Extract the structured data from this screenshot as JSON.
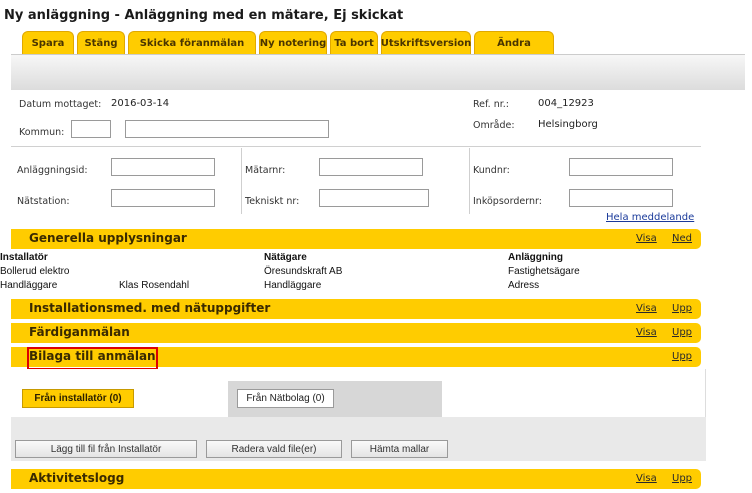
{
  "window": {
    "title": "Ny anläggning - Anläggning med en mätare, Ej skickat"
  },
  "toolbar": {
    "tabs": [
      "Spara",
      "Stäng",
      "Skicka föranmälan",
      "Ny notering",
      "Ta bort",
      "Utskriftsversion",
      "Ändra"
    ]
  },
  "header": {
    "datum_label": "Datum mottaget:",
    "datum_value": "2016-03-14",
    "kommun_label": "Kommun:",
    "ref_label": "Ref. nr.:",
    "ref_value": "004_12923",
    "omrade_label": "Område:",
    "omrade_value": "Helsingborg"
  },
  "fields": {
    "anlaggningsid": "Anläggningsid:",
    "natstation": "Nätstation:",
    "matarnr": "Mätarnr:",
    "tekniskt": "Tekniskt nr:",
    "kundnr": "Kundnr:",
    "inkopsordernr": "Inköpsordernr:",
    "hela_link": "Hela meddelande"
  },
  "sections": {
    "generella": {
      "title": "Generella upplysningar",
      "visa": "Visa",
      "toggle": "Ned"
    },
    "installationsmed": {
      "title": "Installationsmed. med nätuppgifter",
      "visa": "Visa",
      "toggle": "Upp"
    },
    "fardig": {
      "title": "Färdiganmälan",
      "visa": "Visa",
      "toggle": "Upp"
    },
    "bilaga": {
      "title": "Bilaga till anmälan",
      "toggle": "Upp"
    },
    "aktivitet": {
      "title": "Aktivitetslogg",
      "visa": "Visa",
      "toggle": "Upp"
    }
  },
  "generella": {
    "installator_h": "Installatör",
    "installator_v": "Bollerud elektro",
    "handl_label": "Handläggare",
    "handl_value": "Klas Rosendahl",
    "natagare_h": "Nätägare",
    "natagare_v": "Öresundskraft AB",
    "natagare_handl": "Handläggare",
    "anlaggning_h": "Anläggning",
    "fastighetsagare": "Fastighetsägare",
    "adress": "Adress"
  },
  "bilaga": {
    "tab_installator": "Från installatör (0)",
    "tab_natbolag": "Från Nätbolag (0)",
    "btn_lagg": "Lägg till fil från Installatör",
    "btn_radera": "Radera vald file(er)",
    "btn_hamta": "Hämta mallar"
  }
}
